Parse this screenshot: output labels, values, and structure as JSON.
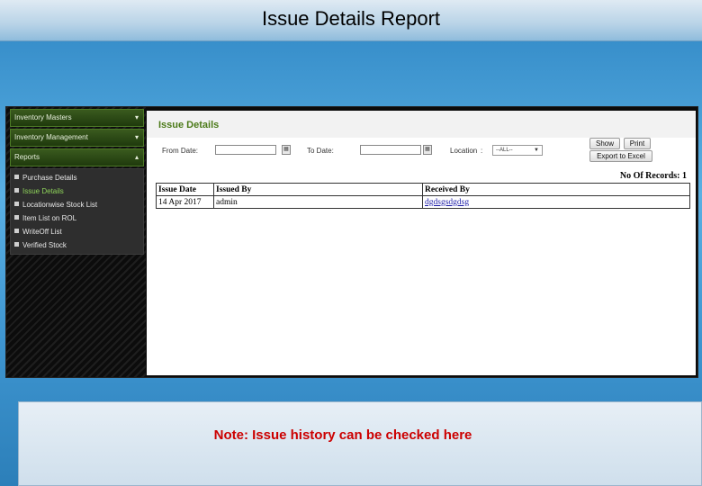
{
  "slide": {
    "title": "Issue Details Report"
  },
  "sidebar": {
    "menus": [
      {
        "label": "Inventory Masters",
        "icon": "chevron-down-icon",
        "glyph": "▾"
      },
      {
        "label": "Inventory Management",
        "icon": "chevron-down-icon",
        "glyph": "▾"
      },
      {
        "label": "Reports",
        "icon": "chevron-up-icon",
        "glyph": "▴"
      }
    ],
    "reports": [
      {
        "label": "Purchase Details"
      },
      {
        "label": "Issue Details"
      },
      {
        "label": "Locationwise Stock List"
      },
      {
        "label": "Item List on ROL"
      },
      {
        "label": "WriteOff List"
      },
      {
        "label": "Verified Stock"
      }
    ],
    "active_report": "Issue Details"
  },
  "content": {
    "heading": "Issue Details",
    "filters": {
      "from_date_label": "From Date:",
      "from_date_value": "",
      "to_date_label": "To Date:",
      "to_date_value": "",
      "location_label": "Location",
      "location_colon": ":",
      "location_selected": "--ALL--"
    },
    "buttons": {
      "show": "Show",
      "print": "Print",
      "export": "Export to Excel"
    },
    "records": "No Of Records: 1",
    "table": {
      "headers": [
        "Issue Date",
        "Issued By",
        "Received By"
      ],
      "rows": [
        [
          "14 Apr 2017",
          "admin",
          "dgdsgsdgdsg"
        ]
      ]
    }
  },
  "note": {
    "text": "Note: Issue history can be checked here"
  },
  "colors": {
    "accent_green": "#4b7a18",
    "active_menu": "#8fd45a",
    "note_red": "#cc0000",
    "link_blue": "#1a1aa6"
  }
}
